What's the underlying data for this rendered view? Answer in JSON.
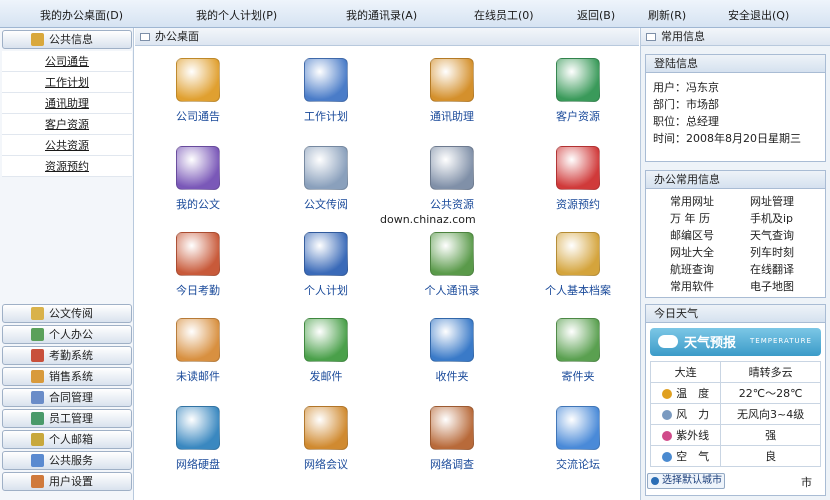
{
  "topnav": [
    {
      "label": "我的办公桌面(D)"
    },
    {
      "label": "我的个人计划(P)"
    },
    {
      "label": "我的通讯录(A)"
    },
    {
      "label": "在线员工(0)"
    },
    {
      "label": "返回(B)"
    },
    {
      "label": "刷新(R)"
    },
    {
      "label": "安全退出(Q)"
    }
  ],
  "sidebar": {
    "open_group": {
      "label": "公共信息",
      "items": [
        "公司通告",
        "工作计划",
        "通讯助理",
        "客户资源",
        "公共资源",
        "资源预约"
      ]
    },
    "groups": [
      {
        "label": "公文传阅",
        "color": "#d9b24a"
      },
      {
        "label": "个人办公",
        "color": "#5aa05a"
      },
      {
        "label": "考勤系统",
        "color": "#c8503c"
      },
      {
        "label": "销售系统",
        "color": "#d89a3c"
      },
      {
        "label": "合同管理",
        "color": "#6a8cc8"
      },
      {
        "label": "员工管理",
        "color": "#4a9a6a"
      },
      {
        "label": "个人邮箱",
        "color": "#c8a83c"
      },
      {
        "label": "公共服务",
        "color": "#5a8ad0"
      },
      {
        "label": "用户设置",
        "color": "#d07a3c"
      }
    ]
  },
  "center": {
    "title": "办公桌面",
    "items": [
      {
        "label": "公司通告",
        "icon": "notice-icon",
        "color": "#e0a030"
      },
      {
        "label": "工作计划",
        "icon": "calendar-icon",
        "color": "#4a7cc8"
      },
      {
        "label": "通讯助理",
        "icon": "address-book-icon",
        "color": "#d4902c"
      },
      {
        "label": "客户资源",
        "icon": "customer-card-icon",
        "color": "#3a9a5a"
      },
      {
        "label": "我的公文",
        "icon": "pen-document-icon",
        "color": "#7a58b8"
      },
      {
        "label": "公文传阅",
        "icon": "document-stack-icon",
        "color": "#8aa0bc"
      },
      {
        "label": "公共资源",
        "icon": "printer-icon",
        "color": "#8090a8"
      },
      {
        "label": "资源预约",
        "icon": "car-icon",
        "color": "#d03a3a"
      },
      {
        "label": "今日考勤",
        "icon": "clock-calendar-icon",
        "color": "#c85a3a"
      },
      {
        "label": "个人计划",
        "icon": "date-14-icon",
        "color": "#3a6ab8"
      },
      {
        "label": "个人通讯录",
        "icon": "person-book-icon",
        "color": "#5a9a4a"
      },
      {
        "label": "个人基本档案",
        "icon": "profile-card-icon",
        "color": "#d4a43c"
      },
      {
        "label": "未读邮件",
        "icon": "unread-mail-icon",
        "color": "#d89040"
      },
      {
        "label": "发邮件",
        "icon": "send-mail-icon",
        "color": "#4aa04a"
      },
      {
        "label": "收件夹",
        "icon": "inbox-icon",
        "color": "#3a7ac8"
      },
      {
        "label": "寄件夹",
        "icon": "outbox-icon",
        "color": "#5aa050"
      },
      {
        "label": "网络硬盘",
        "icon": "hard-disk-icon",
        "color": "#3a88c0"
      },
      {
        "label": "网络会议",
        "icon": "meeting-icon",
        "color": "#d08a30"
      },
      {
        "label": "网络调查",
        "icon": "survey-icon",
        "color": "#b86a3a"
      },
      {
        "label": "交流论坛",
        "icon": "forum-icon",
        "color": "#4a8ad8"
      }
    ],
    "watermark": "down.chinaz.com"
  },
  "right": {
    "title": "常用信息",
    "login": {
      "head": "登陆信息",
      "rows": [
        "用户：冯东京",
        "部门：市场部",
        "职位：总经理",
        "时间：2008年8月20日星期三"
      ]
    },
    "links": {
      "head": "办公常用信息",
      "items": [
        "常用网址",
        "网址管理",
        "万 年 历",
        "手机及ip",
        "邮编区号",
        "天气查询",
        "网址大全",
        "列车时刻",
        "航班查询",
        "在线翻译",
        "常用软件",
        "电子地图"
      ]
    },
    "weather": {
      "head": "今日天气",
      "banner": "天气预报",
      "banner_sub": "TEMPERATURE",
      "city": "大连",
      "condition": "晴转多云",
      "rows": [
        {
          "k": "温　度",
          "v": "22℃～28℃",
          "color": "#e0a020"
        },
        {
          "k": "风　力",
          "v": "无风向3~4级",
          "color": "#7a9ac0"
        },
        {
          "k": "紫外线",
          "v": "强",
          "color": "#d04a8a"
        },
        {
          "k": "空　气",
          "v": "良",
          "color": "#4a8ad0"
        }
      ],
      "city_button": "选择默认城市",
      "suffix": "市"
    }
  }
}
